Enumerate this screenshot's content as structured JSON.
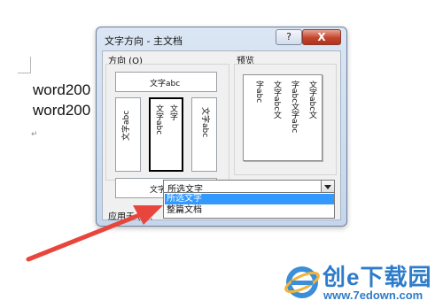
{
  "document": {
    "line1": "word200",
    "line2": "word200",
    "paragraph_mark": "↵"
  },
  "dialog": {
    "title": "文字方向 - 主文档",
    "help_label": "?",
    "close_label": "X",
    "orientation_group": "方向 (O)",
    "preview_group": "预览",
    "tiles": {
      "horizontal": "文字abc",
      "rotate_ccw": "文字abc",
      "stacked_line1": "文字",
      "stacked_line2": "文字abc",
      "rotate_cw": "文字abc",
      "horizontal_flipped": "文字abc"
    },
    "preview_columns": [
      "文字abc文",
      "字abc文字abc",
      "文字abc文",
      "字abc"
    ],
    "apply_to_label": "应用于 (Y):",
    "apply_to_value": "所选文字",
    "dropdown_options": [
      "所选文字",
      "整篇文档"
    ]
  },
  "watermark": {
    "brand": "创e下载园",
    "url": "www.7edown.com"
  },
  "colors": {
    "arrow": "#e8453c",
    "selection": "#3399ff",
    "close_button": "#c4452d"
  }
}
